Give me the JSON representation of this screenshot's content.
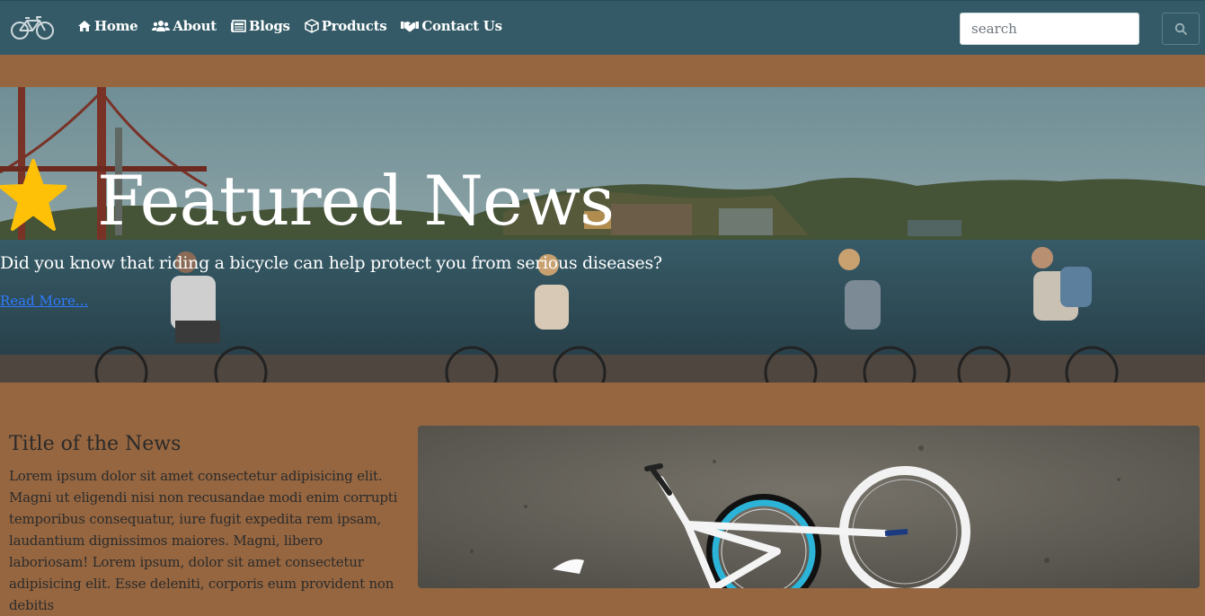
{
  "nav": {
    "brand_icon": "bicycle-icon",
    "links": [
      {
        "label": "Home",
        "icon": "home-icon"
      },
      {
        "label": "About",
        "icon": "users-icon"
      },
      {
        "label": "Blogs",
        "icon": "newspaper-icon"
      },
      {
        "label": "Products",
        "icon": "box-icon"
      },
      {
        "label": "Contact Us",
        "icon": "handshake-icon"
      }
    ],
    "search": {
      "placeholder": "search",
      "button_icon": "search-icon"
    }
  },
  "hero": {
    "icon": "star-icon",
    "title": "Featured News",
    "subtitle": "Did you know that riding a bicycle can help protect you from serious diseases?",
    "link": "Read More..."
  },
  "news": {
    "title": "Title of the News",
    "body": "Lorem ipsum dolor sit amet consectetur adipisicing elit. Magni ut eligendi nisi non recusandae modi enim corrupti temporibus consequatur, iure fugit expedita rem ipsam, laudantium dignissimos maiores. Magni, libero laboriosam! Lorem ipsum, dolor sit amet consectetur adipisicing elit. Esse deleniti, corporis eum provident non debitis"
  },
  "colors": {
    "navbar": "#335a66",
    "page_background": "#966640",
    "link": "#2f7bff",
    "star": "#ffc107"
  }
}
